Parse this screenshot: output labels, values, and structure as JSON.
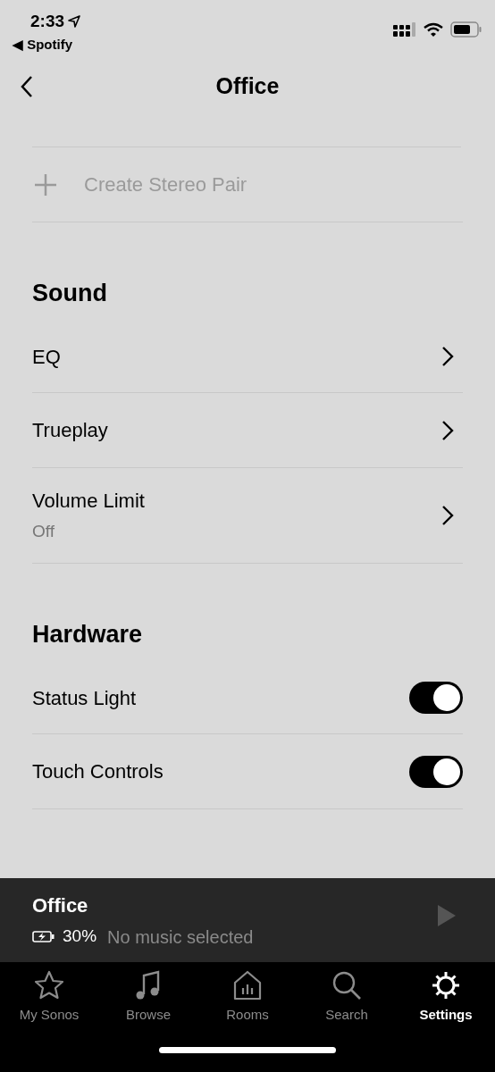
{
  "status_bar": {
    "time": "2:33",
    "back_app": "◀ Spotify"
  },
  "header": {
    "title": "Office"
  },
  "create_pair": {
    "label": "Create Stereo Pair",
    "disabled": true
  },
  "sections": [
    {
      "title": "Sound",
      "items": [
        {
          "kind": "link",
          "label": "EQ"
        },
        {
          "kind": "link",
          "label": "Trueplay"
        },
        {
          "kind": "link",
          "label": "Volume Limit",
          "detail": "Off"
        }
      ]
    },
    {
      "title": "Hardware",
      "items": [
        {
          "kind": "toggle",
          "label": "Status Light",
          "on": true
        },
        {
          "kind": "toggle",
          "label": "Touch Controls",
          "on": true
        }
      ]
    }
  ],
  "now_playing": {
    "room": "Office",
    "battery": "30%",
    "track": "No music selected"
  },
  "tabs": [
    {
      "label": "My Sonos",
      "kind": "star",
      "selected": false
    },
    {
      "label": "Browse",
      "kind": "music",
      "selected": false
    },
    {
      "label": "Rooms",
      "kind": "house",
      "selected": false
    },
    {
      "label": "Search",
      "kind": "search",
      "selected": false
    },
    {
      "label": "Settings",
      "kind": "gear",
      "selected": true
    }
  ]
}
